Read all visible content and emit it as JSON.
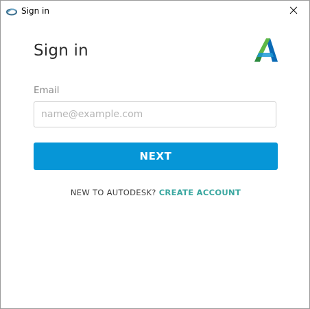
{
  "window": {
    "title": "Sign in"
  },
  "signin": {
    "heading": "Sign in",
    "email_label": "Email",
    "email_placeholder": "name@example.com",
    "email_value": "",
    "next_label": "NEXT",
    "new_text": "NEW TO AUTODESK?",
    "create_account_label": "CREATE ACCOUNT"
  },
  "colors": {
    "accent": "#0696d7",
    "link": "#3aa7a0"
  },
  "icons": {
    "app": "autodesk-app-icon",
    "close": "close-icon",
    "logo": "autodesk-logo"
  }
}
